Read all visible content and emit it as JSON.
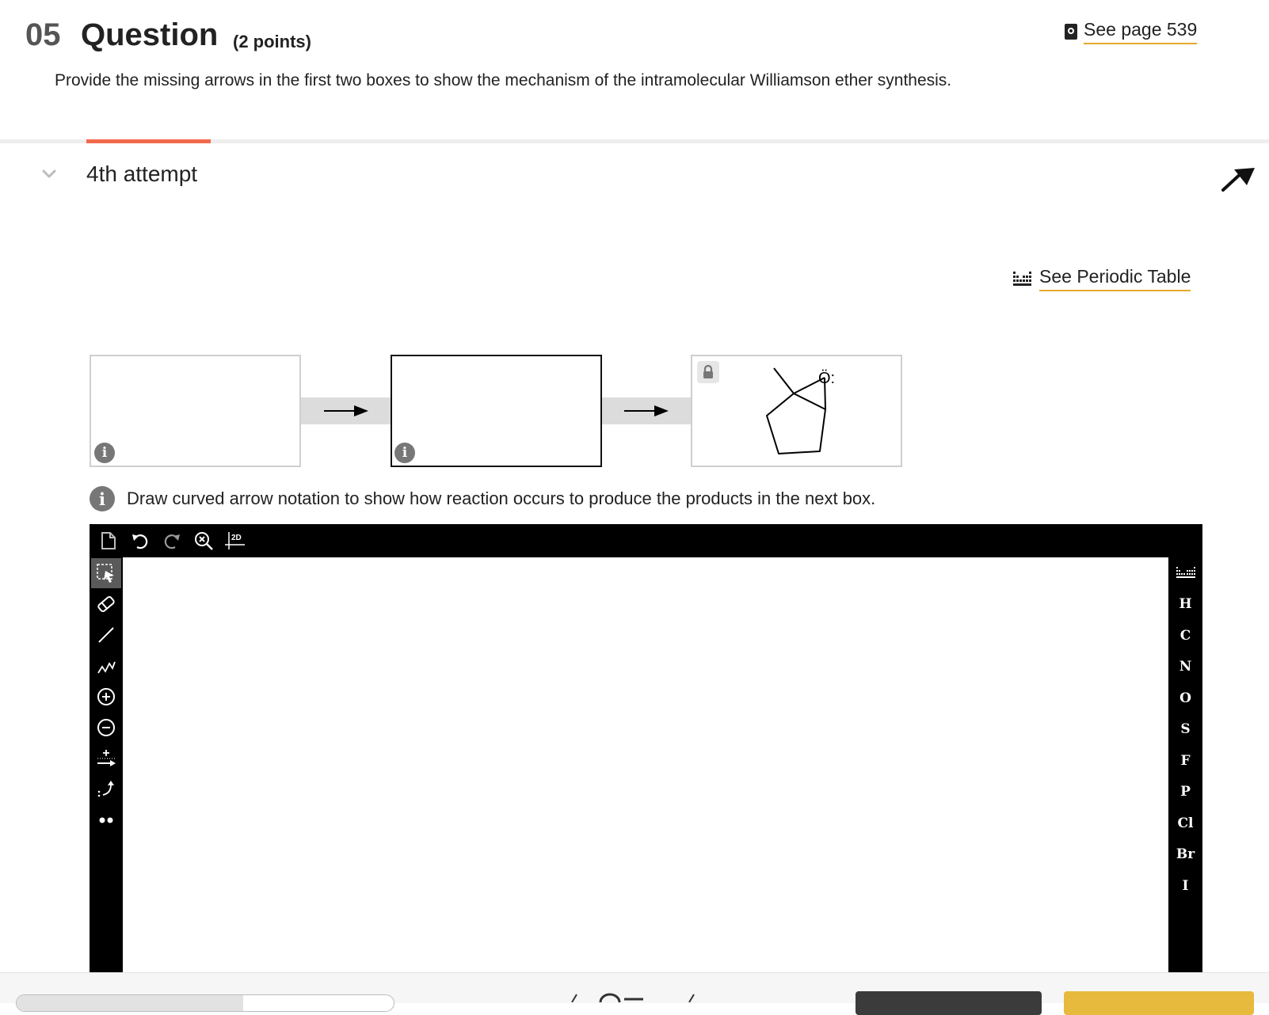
{
  "question": {
    "number": "05",
    "title": "Question",
    "points": "(2 points)",
    "see_page_label": "See page 539",
    "prompt": "Provide the missing arrows in the first two boxes to show the mechanism of the intramolecular Williamson ether synthesis."
  },
  "attempt": {
    "label": "4th attempt"
  },
  "periodic_table_link": "See Periodic Table",
  "reaction": {
    "product_oxygen_label": "Ö:",
    "info_symbol": "i"
  },
  "instruction": "Draw curved arrow notation to show how reaction occurs to produce the products in the next box.",
  "editor": {
    "top_tools": [
      "new-document-icon",
      "undo-icon",
      "redo-icon",
      "zoom-reset-icon",
      "2d-clean-icon"
    ],
    "clean_label": "2D",
    "left_tools": [
      "select-icon",
      "eraser-icon",
      "single-bond-icon",
      "chain-icon",
      "positive-charge-icon",
      "negative-charge-icon",
      "reaction-arrow-icon",
      "curved-arrow-icon",
      "lone-pair-icon"
    ],
    "elements": [
      "H",
      "C",
      "N",
      "O",
      "S",
      "F",
      "P",
      "Cl",
      "Br",
      "I"
    ]
  },
  "colors": {
    "accent": "#f26a4d",
    "link_underline": "#e5a82c",
    "toolbar": "#000000",
    "primary_button": "#e7b93c",
    "secondary_button": "#3b3b3b"
  },
  "footer": {
    "progress_fraction": 0.6
  }
}
